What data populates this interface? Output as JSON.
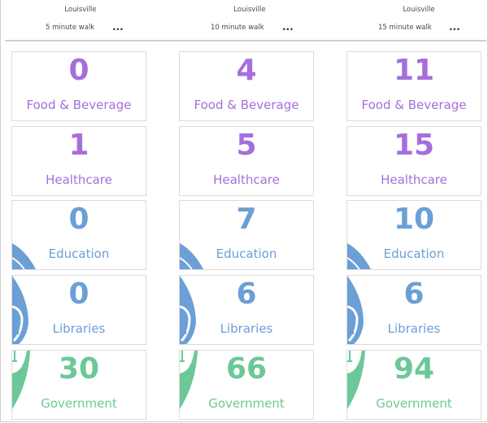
{
  "columns": [
    {
      "location": "Louisville",
      "walk": "5 minute walk",
      "menu_label": "...",
      "cards": [
        {
          "value": "0",
          "category": "Food & Beverage"
        },
        {
          "value": "1",
          "category": "Healthcare"
        },
        {
          "value": "0",
          "category": "Education"
        },
        {
          "value": "0",
          "category": "Libraries"
        },
        {
          "value": "30",
          "category": "Government"
        }
      ]
    },
    {
      "location": "Louisville",
      "walk": "10 minute walk",
      "menu_label": "...",
      "cards": [
        {
          "value": "4",
          "category": "Food & Beverage"
        },
        {
          "value": "5",
          "category": "Healthcare"
        },
        {
          "value": "7",
          "category": "Education"
        },
        {
          "value": "6",
          "category": "Libraries"
        },
        {
          "value": "66",
          "category": "Government"
        }
      ]
    },
    {
      "location": "Louisville",
      "walk": "15 minute walk",
      "menu_label": "...",
      "cards": [
        {
          "value": "11",
          "category": "Food & Beverage"
        },
        {
          "value": "15",
          "category": "Healthcare"
        },
        {
          "value": "10",
          "category": "Education"
        },
        {
          "value": "6",
          "category": "Libraries"
        },
        {
          "value": "94",
          "category": "Government"
        }
      ]
    }
  ],
  "colors": {
    "food_beverage": "#a46fdc",
    "healthcare": "#a46fdc",
    "education": "#6b9fd6",
    "libraries": "#6b9fd6",
    "government": "#6cc896"
  }
}
